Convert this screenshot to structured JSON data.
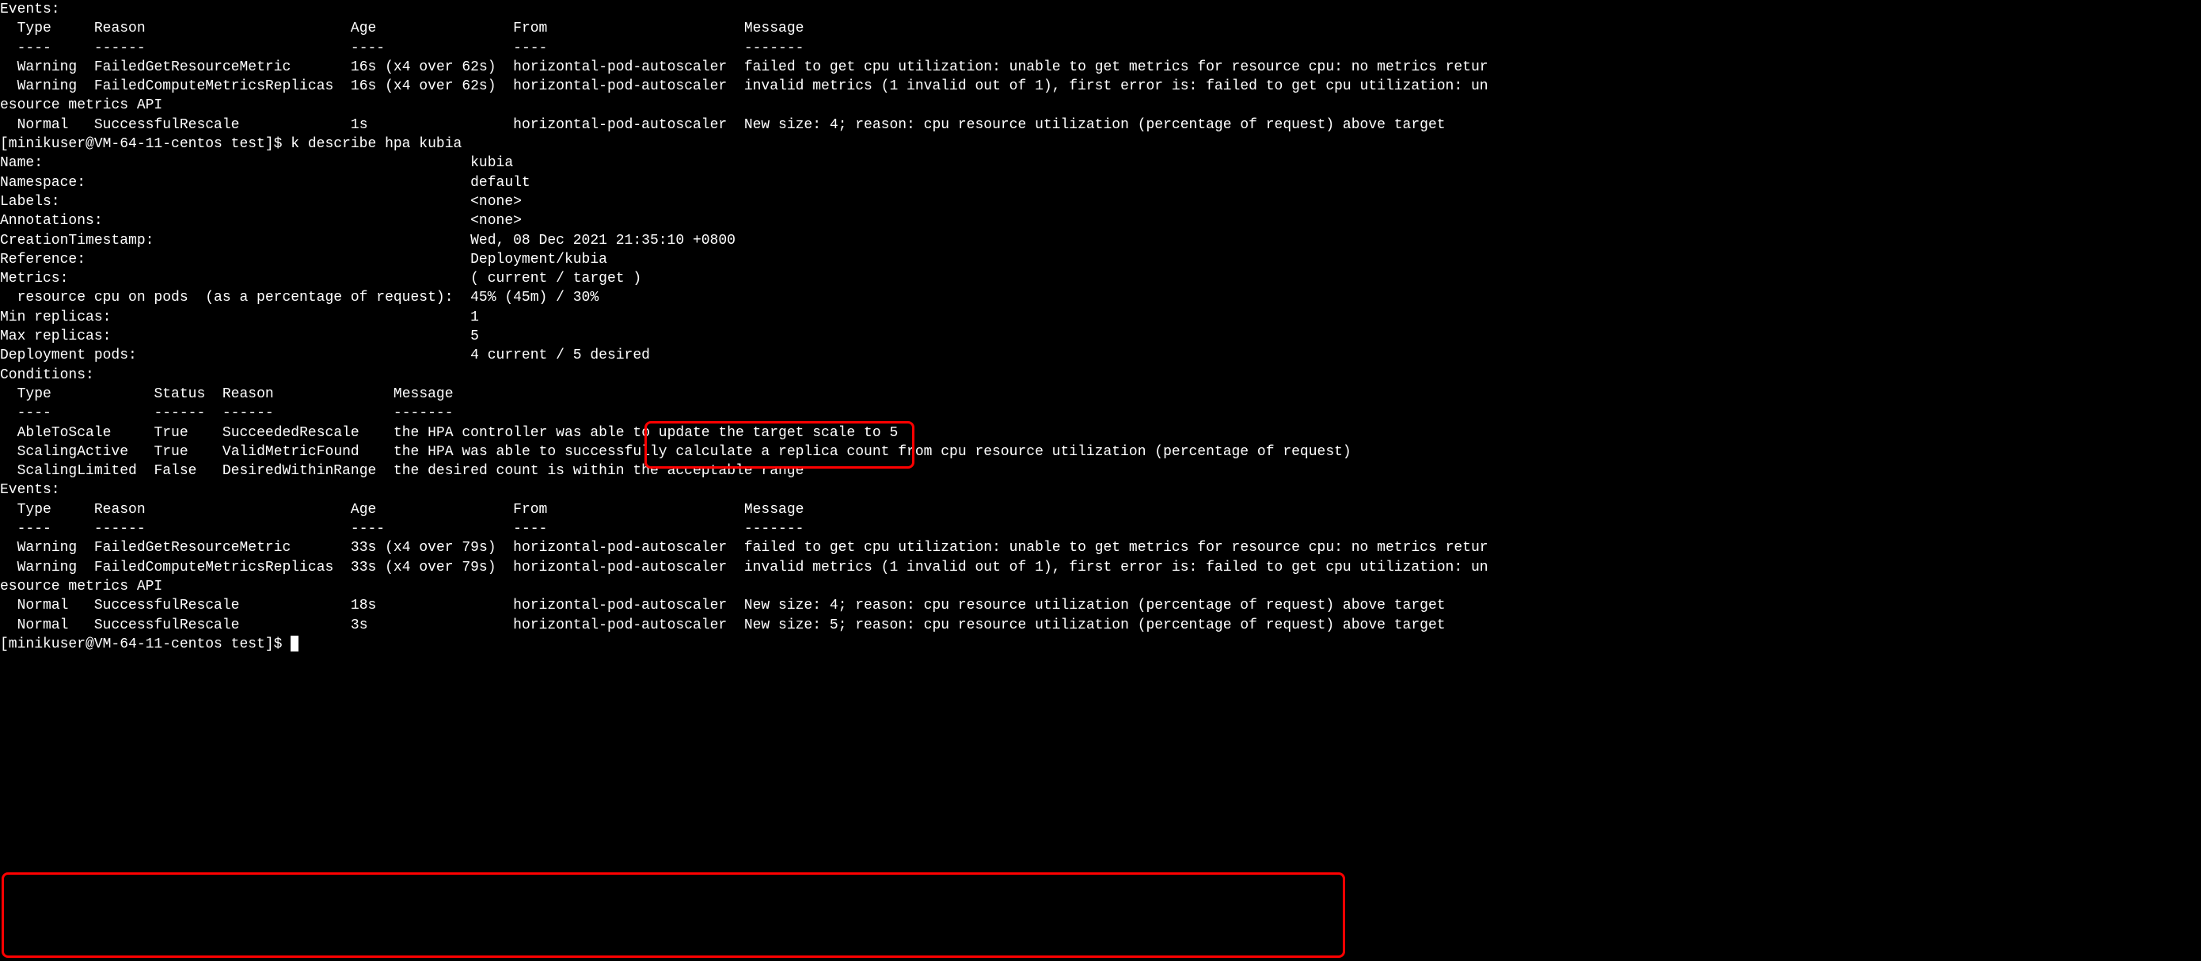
{
  "events1": {
    "header": "Events:",
    "cols": {
      "type": "Type",
      "reason": "Reason",
      "age": "Age",
      "from": "From",
      "message": "Message"
    },
    "sep": {
      "type": "----",
      "reason": "------",
      "age": "----",
      "from": "----",
      "message": "-------"
    },
    "rows": [
      {
        "type": "Warning",
        "reason": "FailedGetResourceMetric",
        "age": "16s (x4 over 62s)",
        "from": "horizontal-pod-autoscaler",
        "message": "failed to get cpu utilization: unable to get metrics for resource cpu: no metrics retur"
      },
      {
        "type": "Warning",
        "reason": "FailedComputeMetricsReplicas",
        "age": "16s (x4 over 62s)",
        "from": "horizontal-pod-autoscaler",
        "message": "invalid metrics (1 invalid out of 1), first error is: failed to get cpu utilization: un"
      }
    ],
    "wrap1": "esource metrics API",
    "row3": {
      "type": "Normal",
      "reason": "SuccessfulRescale",
      "age": "1s",
      "from": "horizontal-pod-autoscaler",
      "message": "New size: 4; reason: cpu resource utilization (percentage of request) above target"
    }
  },
  "prompt1": "[minikuser@VM-64-11-centos test]$ k describe hpa kubia",
  "describe": {
    "name_k": "Name:",
    "name_v": "kubia",
    "namespace_k": "Namespace:",
    "namespace_v": "default",
    "labels_k": "Labels:",
    "labels_v": "<none>",
    "annotations_k": "Annotations:",
    "annotations_v": "<none>",
    "creation_k": "CreationTimestamp:",
    "creation_v": "Wed, 08 Dec 2021 21:35:10 +0800",
    "reference_k": "Reference:",
    "reference_v": "Deployment/kubia",
    "metrics_k": "Metrics:",
    "metrics_v": "( current / target )",
    "cpu_k": "  resource cpu on pods  (as a percentage of request):",
    "cpu_v": "45% (45m) / 30%",
    "minrep_k": "Min replicas:",
    "minrep_v": "1",
    "maxrep_k": "Max replicas:",
    "maxrep_v": "5",
    "deppods_k": "Deployment pods:",
    "deppods_v": "4 current / 5 desired"
  },
  "conditions": {
    "header": "Conditions:",
    "cols": {
      "type": "Type",
      "status": "Status",
      "reason": "Reason",
      "message": "Message"
    },
    "sep": {
      "type": "----",
      "status": "------",
      "reason": "------",
      "message": "-------"
    },
    "rows": [
      {
        "type": "AbleToScale",
        "status": "True",
        "reason": "SucceededRescale",
        "message": "the HPA controller was able to update the target scale to 5"
      },
      {
        "type": "ScalingActive",
        "status": "True",
        "reason": "ValidMetricFound",
        "message": "the HPA was able to successfully calculate a replica count from cpu resource utilization (percentage of request)"
      },
      {
        "type": "ScalingLimited",
        "status": "False",
        "reason": "DesiredWithinRange",
        "message": "the desired count is within the acceptable range"
      }
    ]
  },
  "events2": {
    "header": "Events:",
    "cols": {
      "type": "Type",
      "reason": "Reason",
      "age": "Age",
      "from": "From",
      "message": "Message"
    },
    "sep": {
      "type": "----",
      "reason": "------",
      "age": "----",
      "from": "----",
      "message": "-------"
    },
    "rows": [
      {
        "type": "Warning",
        "reason": "FailedGetResourceMetric",
        "age": "33s (x4 over 79s)",
        "from": "horizontal-pod-autoscaler",
        "message": "failed to get cpu utilization: unable to get metrics for resource cpu: no metrics retur"
      },
      {
        "type": "Warning",
        "reason": "FailedComputeMetricsReplicas",
        "age": "33s (x4 over 79s)",
        "from": "horizontal-pod-autoscaler",
        "message": "invalid metrics (1 invalid out of 1), first error is: failed to get cpu utilization: un"
      }
    ],
    "wrap1": "esource metrics API",
    "row3": {
      "type": "Normal",
      "reason": "SuccessfulRescale",
      "age": "18s",
      "from": "horizontal-pod-autoscaler",
      "message": "New size: 4; reason: cpu resource utilization (percentage of request) above target"
    },
    "row4": {
      "type": "Normal",
      "reason": "SuccessfulRescale",
      "age": "3s",
      "from": "horizontal-pod-autoscaler",
      "message": "New size: 5; reason: cpu resource utilization (percentage of request) above target"
    }
  },
  "prompt2": "[minikuser@VM-64-11-centos test]$ "
}
